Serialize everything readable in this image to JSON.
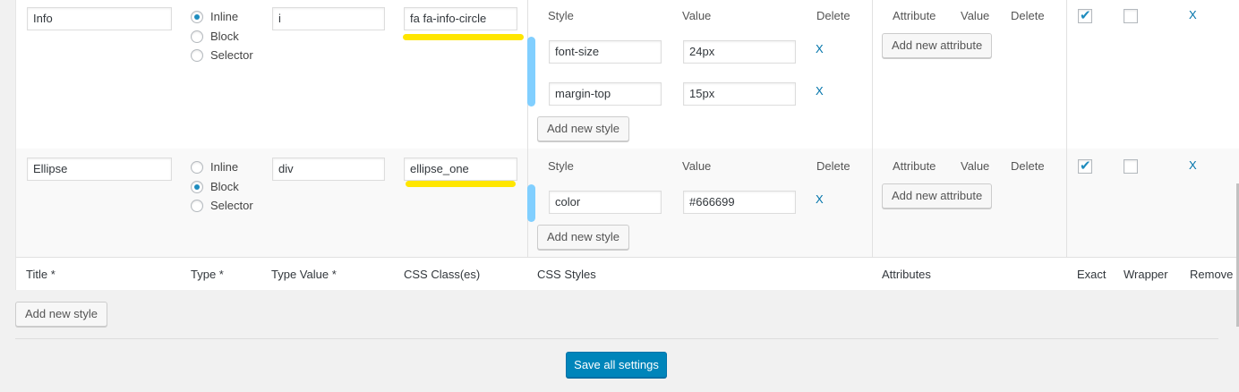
{
  "type_options": {
    "inline": "Inline",
    "block": "Block",
    "selector": "Selector"
  },
  "style_headers": {
    "style": "Style",
    "value": "Value",
    "delete": "Delete"
  },
  "attr_headers": {
    "attribute": "Attribute",
    "value": "Value",
    "delete": "Delete"
  },
  "delete_symbol": "X",
  "buttons": {
    "add_attribute": "Add new attribute",
    "add_style": "Add new style"
  },
  "rows": [
    {
      "title": "Info",
      "type_selected": "Inline",
      "type_value": "i",
      "css_class": "fa fa-info-circle",
      "styles": [
        {
          "name": "font-size",
          "value": "24px"
        },
        {
          "name": "margin-top",
          "value": "15px"
        }
      ],
      "exact": true,
      "wrapper": false
    },
    {
      "title": "Ellipse",
      "type_selected": "Block",
      "type_value": "div",
      "css_class": "ellipse_one",
      "styles": [
        {
          "name": "color",
          "value": "#666699"
        }
      ],
      "exact": true,
      "wrapper": false
    }
  ],
  "footer_headers": {
    "title": "Title *",
    "type": "Type *",
    "type_value": "Type Value *",
    "css_classes": "CSS Class(es)",
    "css_styles": "CSS Styles",
    "attributes": "Attributes",
    "exact": "Exact",
    "wrapper": "Wrapper",
    "remove": "Remove"
  },
  "add_style_main": "Add new style",
  "save_label": "Save all settings",
  "colors": {
    "accent": "#0085ba",
    "highlight_yellow": "#ffe600",
    "highlight_blue": "#81cfff"
  }
}
